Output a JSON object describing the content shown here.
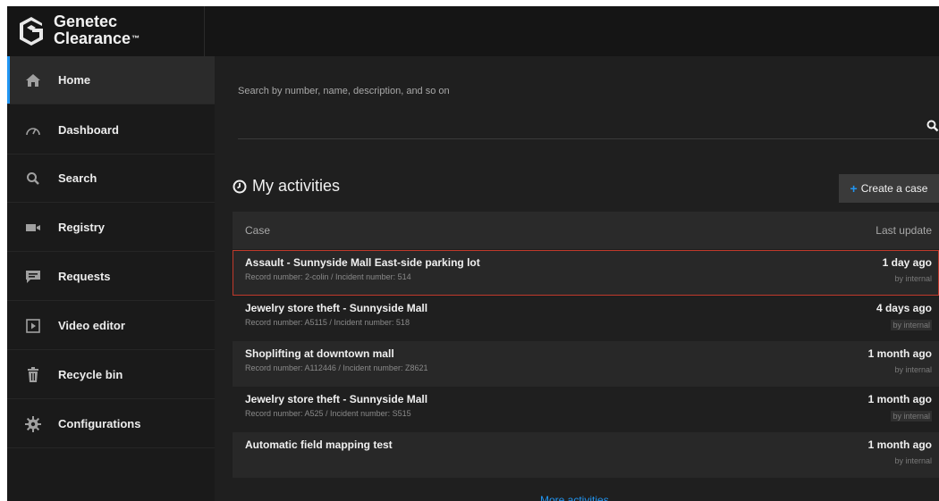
{
  "brand": {
    "line1": "Genetec",
    "line2": "Clearance",
    "tm": "™"
  },
  "colors": {
    "accent": "#2196f3",
    "selected_outline": "#c0392b"
  },
  "sidebar": {
    "items": [
      {
        "label": "Home",
        "icon": "home-icon",
        "active": true
      },
      {
        "label": "Dashboard",
        "icon": "gauge-icon",
        "active": false
      },
      {
        "label": "Search",
        "icon": "search-icon",
        "active": false
      },
      {
        "label": "Registry",
        "icon": "video-camera-icon",
        "active": false
      },
      {
        "label": "Requests",
        "icon": "chat-bubble-icon",
        "active": false
      },
      {
        "label": "Video editor",
        "icon": "play-box-icon",
        "active": false
      },
      {
        "label": "Recycle bin",
        "icon": "trash-icon",
        "active": false
      },
      {
        "label": "Configurations",
        "icon": "gear-icon",
        "active": false
      }
    ]
  },
  "search": {
    "placeholder": "Search by number, name, description, and so on"
  },
  "activities": {
    "title": "My activities",
    "create_label": "Create a case",
    "col_case": "Case",
    "col_update": "Last update",
    "rows": [
      {
        "title": "Assault - Sunnyside Mall East-side parking lot",
        "sub": "Record number: 2-colin / Incident number: 514",
        "time": "1 day ago",
        "by": "by internal",
        "selected": true
      },
      {
        "title": "Jewelry store theft - Sunnyside Mall",
        "sub": "Record number: A5115 / Incident number: 518",
        "time": "4 days ago",
        "by": "by internal",
        "selected": false
      },
      {
        "title": "Shoplifting at downtown mall",
        "sub": "Record number: A112446 / Incident number: Z8621",
        "time": "1 month ago",
        "by": "by internal",
        "selected": false
      },
      {
        "title": "Jewelry store theft - Sunnyside Mall",
        "sub": "Record number: A525 / Incident number: S515",
        "time": "1 month ago",
        "by": "by internal",
        "selected": false
      },
      {
        "title": "Automatic field mapping test",
        "sub": "",
        "time": "1 month ago",
        "by": "by internal",
        "selected": false
      }
    ],
    "more_label": "More activities"
  }
}
